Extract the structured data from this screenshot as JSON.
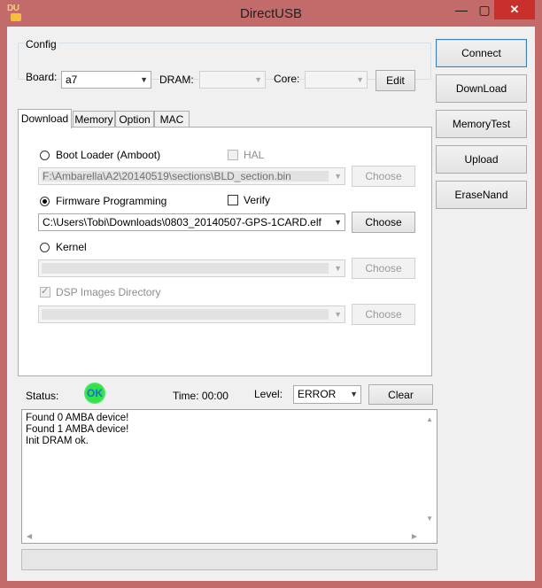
{
  "window": {
    "title": "DirectUSB",
    "min_glyph": "—",
    "max_glyph": "▢",
    "close_glyph": "✕"
  },
  "app_icon": {
    "text": "DU"
  },
  "config": {
    "group_label": "Config",
    "board_label": "Board:",
    "board_value": "a7",
    "dram_label": "DRAM:",
    "dram_value": "",
    "core_label": "Core:",
    "core_value": "",
    "edit_label": "Edit"
  },
  "tabs": [
    {
      "label": "Download"
    },
    {
      "label": "Memory"
    },
    {
      "label": "Option"
    },
    {
      "label": "MAC"
    }
  ],
  "download": {
    "bootloader_label": "Boot Loader (Amboot)",
    "bootloader_selected": false,
    "hal_label": "HAL",
    "bootloader_path": "F:\\Ambarella\\A2\\20140519\\sections\\BLD_section.bin",
    "firmware_label": "Firmware Programming",
    "firmware_selected": true,
    "verify_label": "Verify",
    "firmware_path": "C:\\Users\\Tobi\\Downloads\\0803_20140507-GPS-1CARD.elf",
    "kernel_label": "Kernel",
    "kernel_selected": false,
    "kernel_path": "",
    "dsp_label": "DSP Images Directory",
    "dsp_checked": true,
    "dsp_path": "",
    "choose_label": "Choose"
  },
  "side_buttons": [
    {
      "label": "Connect"
    },
    {
      "label": "DownLoad"
    },
    {
      "label": "MemoryTest"
    },
    {
      "label": "Upload"
    },
    {
      "label": "EraseNand"
    }
  ],
  "status": {
    "status_label": "Status:",
    "indicator": "OK",
    "time_label": "Time: 00:00",
    "level_label": "Level:",
    "level_value": "ERROR",
    "clear_label": "Clear"
  },
  "log": [
    "Found 0 AMBA device!",
    "Found 1 AMBA device!",
    "Init DRAM ok."
  ],
  "progress": 0
}
